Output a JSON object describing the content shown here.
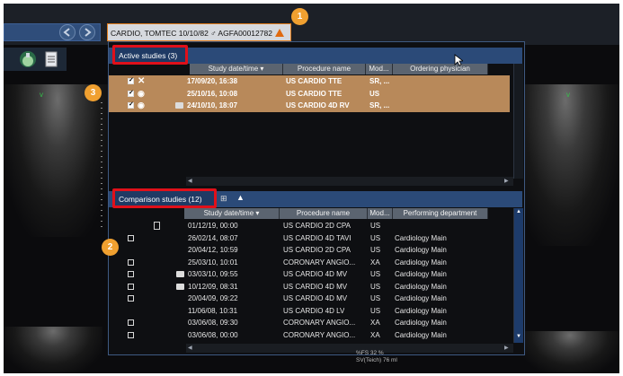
{
  "header": {
    "patient_info": "CARDIO, TOMTEC 10/10/82 ♂ AGFA00012782"
  },
  "icons": {
    "nav_back": "arrow-left-icon",
    "nav_forward": "arrow-right-icon",
    "flask": "flask-icon",
    "document": "document-icon",
    "warning": "warning-icon"
  },
  "badges": [
    "1",
    "2",
    "3"
  ],
  "active_studies": {
    "tab_label": "Active studies (3)",
    "columns": [
      "Study date/time ▾",
      "Procedure name",
      "Mod...",
      "Ordering physician"
    ],
    "rows": [
      {
        "date": "17/09/20, 16:38",
        "procedure": "US CARDIO TTE",
        "mod": "SR, ...",
        "physician": ""
      },
      {
        "date": "25/10/16, 10:08",
        "procedure": "US CARDIO TTE",
        "mod": "US",
        "physician": ""
      },
      {
        "date": "24/10/10, 18:07",
        "procedure": "US CARDIO 4D RV",
        "mod": "SR, ...",
        "physician": ""
      }
    ]
  },
  "comparison_studies": {
    "tab_label": "Comparison studies (12)",
    "columns": [
      "Study date/time ▾",
      "Procedure name",
      "Mod...",
      "Performing department"
    ],
    "rows": [
      {
        "date": "01/12/19, 00:00",
        "procedure": "US CARDIO 2D CPA",
        "mod": "US",
        "department": ""
      },
      {
        "date": "26/02/14, 08:07",
        "procedure": "US CARDIO 4D TAVI",
        "mod": "US",
        "department": "Cardiology Main"
      },
      {
        "date": "20/04/12, 10:59",
        "procedure": "US CARDIO 2D CPA",
        "mod": "US",
        "department": "Cardiology Main"
      },
      {
        "date": "25/03/10, 10:01",
        "procedure": "CORONARY ANGIO...",
        "mod": "XA",
        "department": "Cardiology Main"
      },
      {
        "date": "03/03/10, 09:55",
        "procedure": "US CARDIO 4D MV",
        "mod": "US",
        "department": "Cardiology Main"
      },
      {
        "date": "10/12/09, 08:31",
        "procedure": "US CARDIO 4D MV",
        "mod": "US",
        "department": "Cardiology Main"
      },
      {
        "date": "20/04/09, 09:22",
        "procedure": "US CARDIO 4D MV",
        "mod": "US",
        "department": "Cardiology Main"
      },
      {
        "date": "11/06/08, 10:31",
        "procedure": "US CARDIO 4D LV",
        "mod": "US",
        "department": "Cardiology Main"
      },
      {
        "date": "03/06/08, 09:30",
        "procedure": "CORONARY ANGIO...",
        "mod": "XA",
        "department": "Cardiology Main"
      },
      {
        "date": "03/06/08, 00:00",
        "procedure": "CORONARY ANGIO...",
        "mod": "XA",
        "department": "Cardiology Main"
      }
    ]
  },
  "stats": {
    "line1": "%FS            32 %",
    "line2": "SV(Teich)      76 ml"
  },
  "colors": {
    "active_row": "#b8895a",
    "header_blue": "#2b4a78",
    "highlight_red": "#e0101a",
    "badge_orange": "#f0a030"
  }
}
